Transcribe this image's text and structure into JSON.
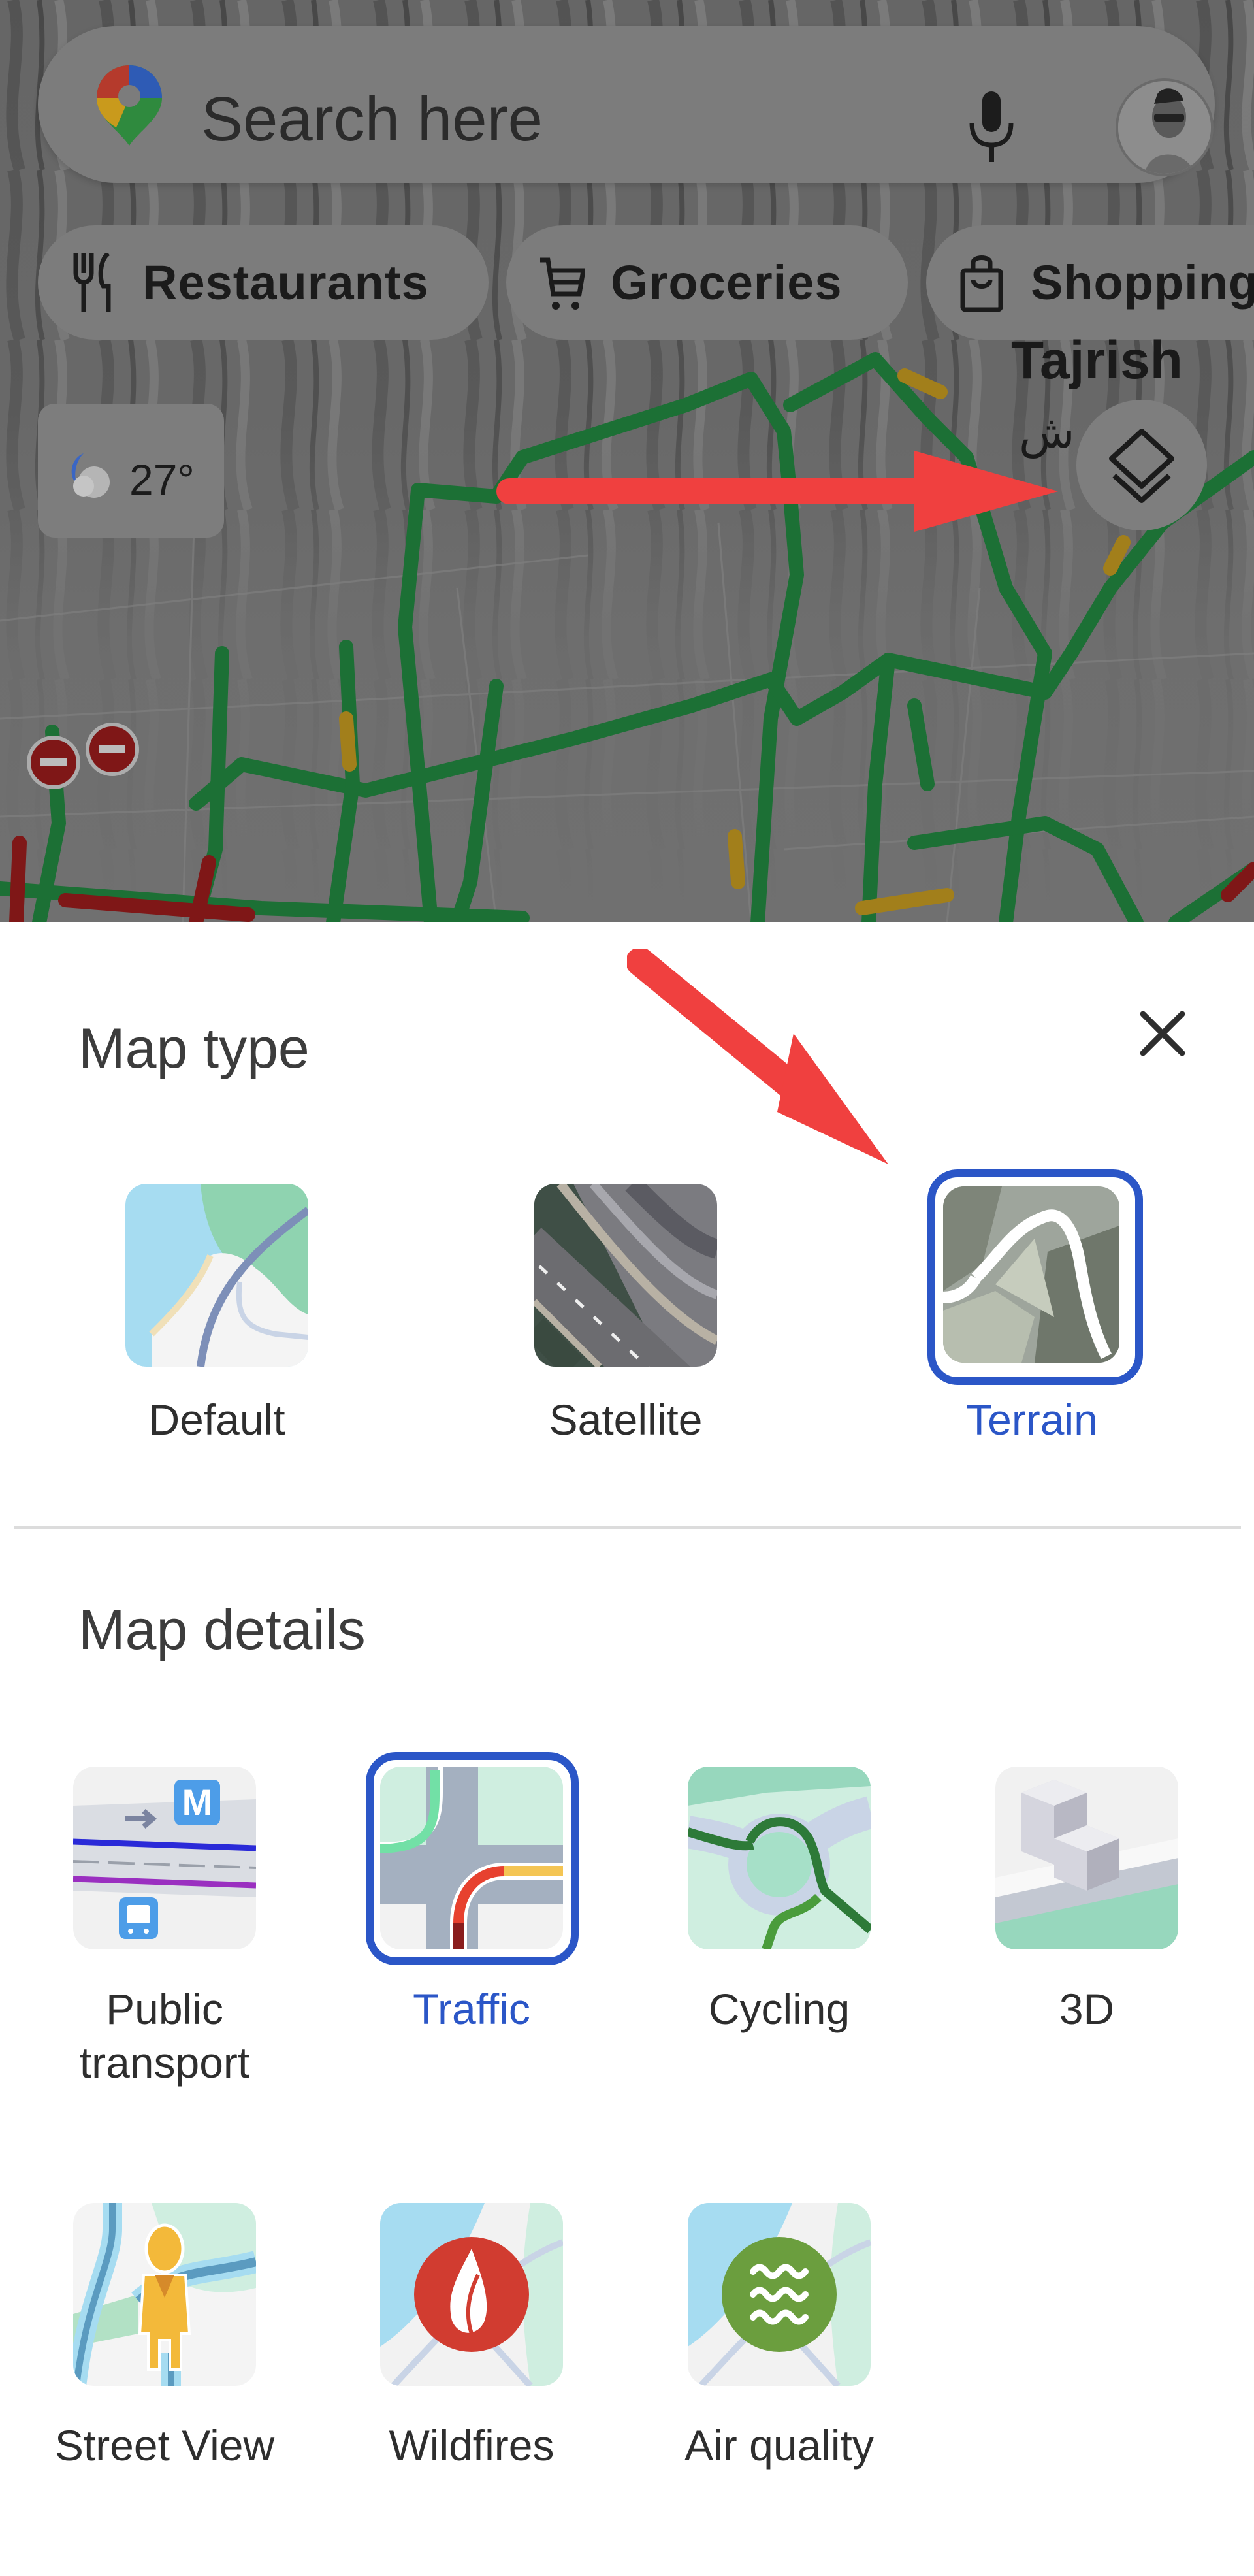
{
  "search": {
    "placeholder": "Search here",
    "logo_icon": "google-maps-pin-icon",
    "mic_icon": "microphone-icon",
    "avatar_icon": "user-avatar"
  },
  "chips": [
    {
      "label": "Restaurants",
      "icon": "fork-knife-icon"
    },
    {
      "label": "Groceries",
      "icon": "shopping-cart-icon"
    },
    {
      "label": "Shopping",
      "icon": "shopping-bag-icon"
    }
  ],
  "map": {
    "place_label": "Tajrish",
    "place_label_local": "ش",
    "weather": {
      "temperature": "27°",
      "icon": "partly-cloudy-night-icon"
    },
    "layers_button_icon": "layers-icon",
    "traffic_colors": {
      "free": "#1f7a3a",
      "slow": "#b08a1e",
      "jam": "#8a1a1a"
    }
  },
  "annotations": {
    "arrow_color": "#f0403f"
  },
  "sheet": {
    "map_type_title": "Map type",
    "close_icon": "close-icon",
    "map_types": [
      {
        "label": "Default",
        "selected": false
      },
      {
        "label": "Satellite",
        "selected": false
      },
      {
        "label": "Terrain",
        "selected": true
      }
    ],
    "map_details_title": "Map details",
    "map_details": [
      {
        "label": "Public transport",
        "selected": false
      },
      {
        "label": "Traffic",
        "selected": true
      },
      {
        "label": "Cycling",
        "selected": false
      },
      {
        "label": "3D",
        "selected": false
      },
      {
        "label": "Street View",
        "selected": false
      },
      {
        "label": "Wildfires",
        "selected": false
      },
      {
        "label": "Air quality",
        "selected": false
      }
    ],
    "accent_color": "#2b56c7"
  }
}
